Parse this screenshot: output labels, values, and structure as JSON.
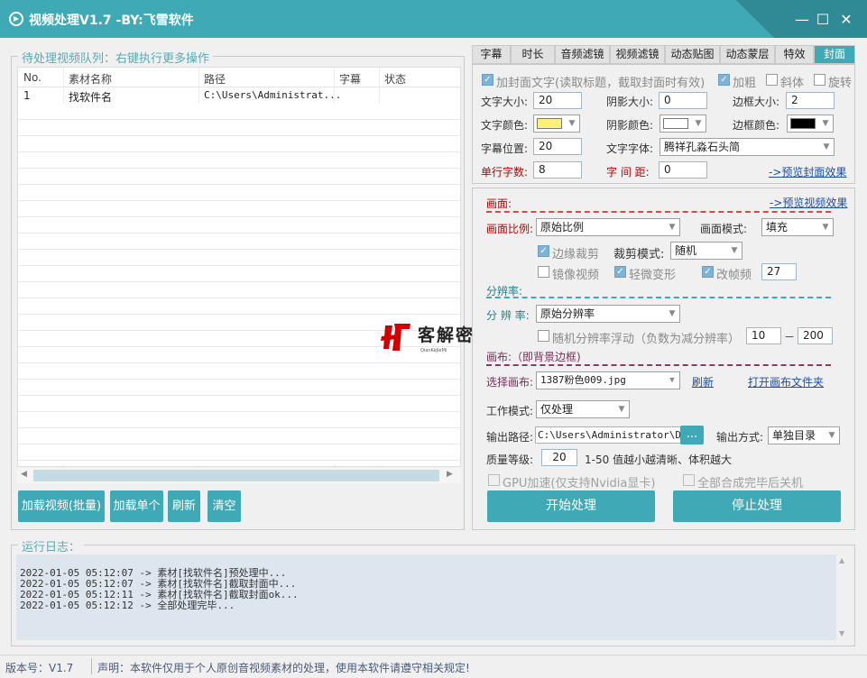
{
  "window": {
    "title": "视频处理V1.7 -BY:飞雪软件",
    "minimize": "—",
    "maximize": "☐",
    "close": "✕"
  },
  "queue": {
    "title": "待处理视频队列：右键执行更多操作",
    "columns": [
      "No.",
      "素材名称",
      "路径",
      "字幕",
      "状态"
    ],
    "rows": [
      {
        "no": "1",
        "name": "找软件名",
        "path": "C:\\Users\\Administrat...",
        "sub": "",
        "status": ""
      }
    ],
    "buttons": {
      "load_batch": "加载视频(批量)",
      "load_single": "加载单个",
      "refresh": "刷新",
      "clear": "清空"
    }
  },
  "tabs": [
    "字幕",
    "时长",
    "音频滤镜",
    "视频滤镜",
    "动态贴图",
    "动态蒙层",
    "特效",
    "封面"
  ],
  "cover": {
    "add_text": "加封面文字(读取标题，截取封面时有效)",
    "bold": "加粗",
    "italic": "斜体",
    "rotate": "旋转",
    "font_size_label": "文字大小:",
    "font_size": "20",
    "shadow_size_label": "阴影大小:",
    "shadow_size": "0",
    "border_size_label": "边框大小:",
    "border_size": "2",
    "font_color_label": "文字颜色:",
    "font_color": "#fff07a",
    "shadow_color_label": "阴影颜色:",
    "shadow_color": "#ffffff",
    "border_color_label": "边框颜色:",
    "border_color": "#000000",
    "sub_pos_label": "字幕位置:",
    "sub_pos": "20",
    "font_face_label": "文字字体:",
    "font_face": "腾祥孔淼石头简",
    "chars_label": "单行字数:",
    "chars": "8",
    "spacing_label": "字 间 距:",
    "spacing": "0",
    "preview": "->预览封面效果"
  },
  "frame": {
    "title": "画面:",
    "preview": "->预览视频效果",
    "ratio_label": "画面比例:",
    "ratio": "原始比例",
    "mode_label": "画面模式:",
    "mode": "填充",
    "edge_crop": "边缘裁剪",
    "crop_mode_label": "裁剪模式:",
    "crop_mode": "随机",
    "mirror": "镜像视频",
    "deform": "轻微变形",
    "fps": "改帧频",
    "fps_value": "27"
  },
  "resolution": {
    "title": "分辨率:",
    "label": "分 辨 率:",
    "value": "原始分辨率",
    "random": "随机分辨率浮动（负数为减分辨率）",
    "min": "10",
    "sep": "－",
    "max": "200"
  },
  "canvas": {
    "title": "画布:（即背景边框)",
    "label": "选择画布:",
    "value": "1387粉色009.jpg",
    "refresh": "刷新",
    "open_folder": "打开画布文件夹"
  },
  "work": {
    "mode_label": "工作模式:",
    "mode": "仅处理",
    "out_path_label": "输出路径:",
    "out_path": "C:\\Users\\Administrator\\Des",
    "browse": "...",
    "out_mode_label": "输出方式:",
    "out_mode": "单独目录",
    "quality_label": "质量等级:",
    "quality": "20",
    "quality_hint": "1-50 值越小越清晰、体积越大",
    "gpu": "GPU加速(仅支持Nvidia显卡)",
    "shutdown": "全部合成完毕后关机",
    "start": "开始处理",
    "stop": "停止处理"
  },
  "log": {
    "title": "运行日志：",
    "lines": [
      "2022-01-05 05:12:07 -> 素材[找软件名]预处理中...",
      "2022-01-05 05:12:07 -> 素材[找软件名]截取封面中...",
      "2022-01-05 05:12:11 -> 素材[找软件名]截取封面ok...",
      "2022-01-05 05:12:12 -> 全部处理完毕..."
    ]
  },
  "status": {
    "version": "版本号：V1.7",
    "notice": "声明：本软件仅用于个人原创音视频素材的处理，使用本软件请遵守相关规定!"
  },
  "watermark": {
    "text": "客解密",
    "sub": "QianKeJieMi"
  }
}
